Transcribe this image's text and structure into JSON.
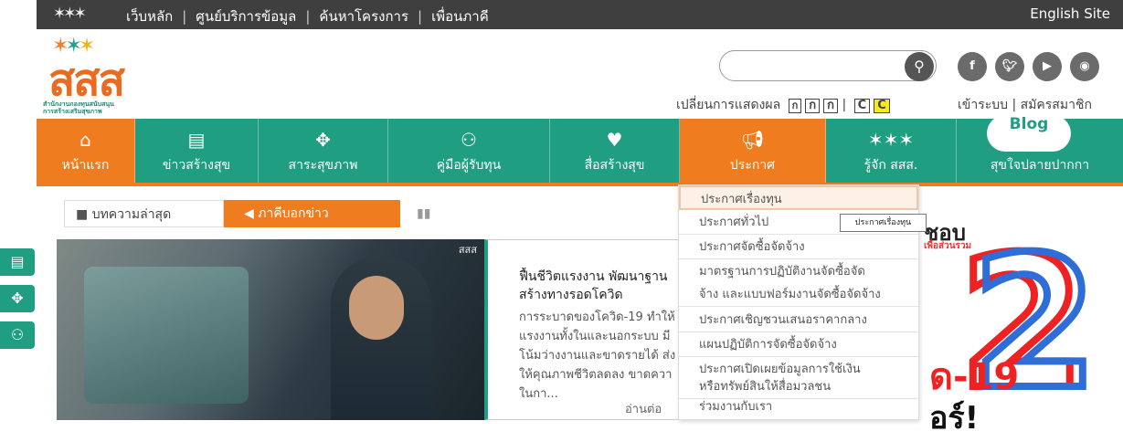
{
  "topbar": {
    "links": [
      "เว็บหลัก",
      "ศูนย์บริการข้อมูล",
      "ค้นหาโครงการ",
      "เพื่อนภาคี"
    ],
    "english_site": "English Site"
  },
  "logo": {
    "mark": "สสส",
    "sub1": "สำนักงานกองทุนสนับสนุน",
    "sub2": "การสร้างเสริมสุขภาพ"
  },
  "header": {
    "display_label": "เปลี่ยนการแสดงผล",
    "font_boxes": [
      "ก",
      "ก",
      "ก"
    ],
    "contrast_boxes": [
      "C",
      "C"
    ],
    "login_label": "เข้าระบบ | สมัครสมาชิก",
    "social_icons": [
      "facebook-icon",
      "twitter-icon",
      "youtube-icon",
      "rss-icon"
    ]
  },
  "nav": {
    "items": [
      {
        "label": "หน้าแรก",
        "icon": "home-icon"
      },
      {
        "label": "ข่าวสร้างสุข",
        "icon": "document-icon"
      },
      {
        "label": "สาระสุขภาพ",
        "icon": "book-icon"
      },
      {
        "label": "คู่มือผู้รับทุน",
        "icon": "users-icon"
      },
      {
        "label": "สื่อสร้างสุข",
        "icon": "heart-icon"
      },
      {
        "label": "ประกาศ",
        "icon": "megaphone-icon"
      },
      {
        "label": "รู้จัก สสส.",
        "icon": "logo-stars-icon"
      },
      {
        "label": "สุขใจปลายปากกา",
        "icon": "blog-icon"
      }
    ],
    "blog_label": "Blog",
    "active_index": 5,
    "active_color": "#ef7d1f",
    "bar_color": "#1f9e82"
  },
  "tabs": {
    "latest": "บทความล่าสุด",
    "partner_news": "ภาคีบอกข่าว"
  },
  "news": {
    "title1": "ฟื้นชีวิตแรงงาน พัฒนาฐาน",
    "title2": "สร้างทางรอดโควิด",
    "body1": "การระบาดของโควิด-19 ทำให้",
    "body2": "แรงงานทั้งในและนอกระบบ มี",
    "body3": "โน้มว่างงานและขาดรายได้ ส่ง",
    "body4": "ให้คุณภาพชีวิตลดลง ขาดควา",
    "body5": "ในกา...",
    "more": "อ่านต่อ",
    "photo_brand": "สสส"
  },
  "right_ad": {
    "line1": "ชอบ",
    "line1_sub": "เพื่อส่วนรวม",
    "big": "2",
    "line2": "ด-19",
    "line3": "อร์!"
  },
  "dropdown": {
    "items": [
      "ประกาศเรื่องทุน",
      "ประกาศทั่วไป",
      "ประกาศจัดซื้อจัดจ้าง",
      "มาตรฐานการปฏิบัติงานจัดซื้อจัด",
      "จ้าง และแบบฟอร์มงานจัดซื้อจัดจ้าง",
      "ประกาศเชิญชวนเสนอราคากลาง",
      "แผนปฏิบัติการจัดซื้อจัดจ้าง",
      "ประกาศเปิดเผยข้อมูลการใช้เงิน",
      "หรือทรัพย์สินให้สื่อมวลชน",
      "ร่วมงานกับเรา"
    ],
    "hover_index": 0,
    "tooltip": "ประกาศเรื่องทุน"
  }
}
